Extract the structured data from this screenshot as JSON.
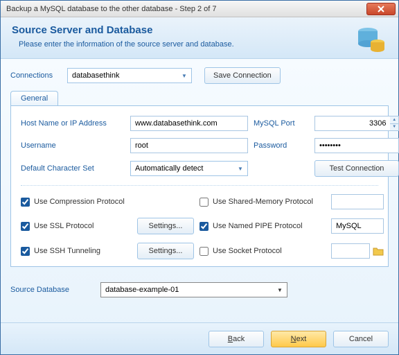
{
  "window": {
    "title": "Backup a MySQL database to the other database - Step 2 of 7"
  },
  "header": {
    "title": "Source Server and Database",
    "subtitle": "Please enter the information of the source server and database."
  },
  "connections": {
    "label": "Connections",
    "selected": "databasethink",
    "save_btn": "Save Connection"
  },
  "tabs": {
    "general": "General"
  },
  "form": {
    "host_label": "Host Name or IP Address",
    "host_value": "www.databasethink.com",
    "port_label": "MySQL Port",
    "port_value": "3306",
    "user_label": "Username",
    "user_value": "root",
    "pass_label": "Password",
    "pass_value": "••••••••",
    "charset_label": "Default Character Set",
    "charset_value": "Automatically detect",
    "test_btn": "Test Connection"
  },
  "options": {
    "compression": {
      "label": "Use Compression Protocol",
      "checked": true
    },
    "ssl": {
      "label": "Use SSL Protocol",
      "checked": true,
      "settings": "Settings..."
    },
    "ssh": {
      "label": "Use SSH Tunneling",
      "checked": true,
      "settings": "Settings..."
    },
    "shared": {
      "label": "Use Shared-Memory Protocol",
      "checked": false,
      "value": ""
    },
    "pipe": {
      "label": "Use Named PIPE Protocol",
      "checked": true,
      "value": "MySQL"
    },
    "socket": {
      "label": "Use Socket Protocol",
      "checked": false,
      "value": ""
    }
  },
  "source_db": {
    "label": "Source Database",
    "selected": "database-example-01"
  },
  "footer": {
    "back": "Back",
    "next": "Next",
    "cancel": "Cancel"
  }
}
